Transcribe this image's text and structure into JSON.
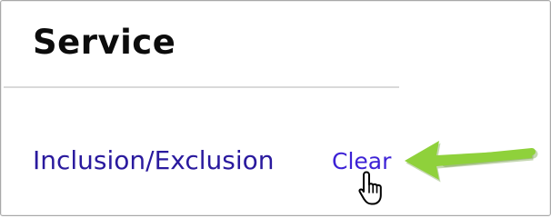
{
  "section": {
    "title": "Service"
  },
  "filter": {
    "label": "Inclusion/Exclusion",
    "clear_label": "Clear"
  },
  "colors": {
    "label": "#2a1a9e",
    "link": "#3d22d6",
    "annotation_arrow": "#8fd13b"
  },
  "icons": {
    "cursor": "hand-pointer-icon",
    "annotation": "arrow-left-icon"
  }
}
